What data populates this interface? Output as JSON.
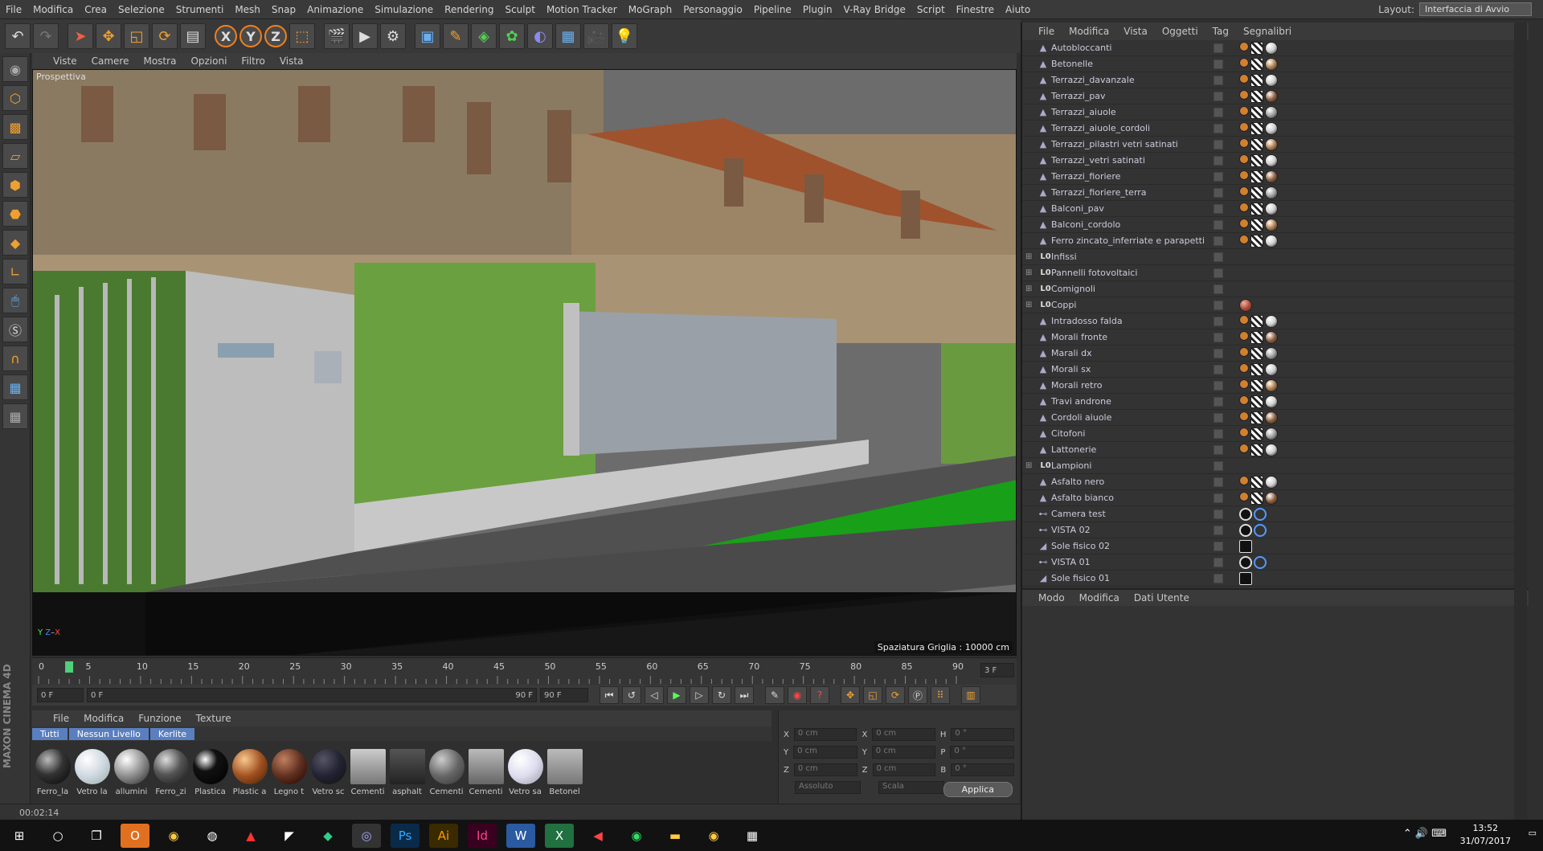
{
  "menubar": {
    "items": [
      "File",
      "Modifica",
      "Crea",
      "Selezione",
      "Strumenti",
      "Mesh",
      "Snap",
      "Animazione",
      "Simulazione",
      "Rendering",
      "Sculpt",
      "Motion Tracker",
      "MoGraph",
      "Personaggio",
      "Pipeline",
      "Plugin",
      "V-Ray Bridge",
      "Script",
      "Finestre",
      "Aiuto"
    ],
    "layout_label": "Layout:",
    "layout_value": "Interfaccia di Avvio"
  },
  "viewport": {
    "menu": [
      "Viste",
      "Camere",
      "Mostra",
      "Opzioni",
      "Filtro",
      "Vista"
    ],
    "label": "Prospettiva",
    "grid": "Spaziatura Griglia : 10000 cm"
  },
  "timeline": {
    "ticks": [
      "0",
      "5",
      "10",
      "15",
      "20",
      "25",
      "30",
      "35",
      "40",
      "45",
      "50",
      "55",
      "60",
      "65",
      "70",
      "75",
      "80",
      "85",
      "90"
    ],
    "current": "3",
    "frame_field": "3 F"
  },
  "playbar": {
    "start": "0 F",
    "field2": "0 F",
    "end": "90 F",
    "end2": "90 F"
  },
  "materials": {
    "menu": [
      "File",
      "Modifica",
      "Funzione",
      "Texture"
    ],
    "tabs": [
      "Tutti",
      "Nessun Livello",
      "Kerlite"
    ],
    "items": [
      "Ferro_la",
      "Vetro la",
      "allumini",
      "Ferro_zi",
      "Plastica",
      "Plastic a",
      "Legno t",
      "Vetro sc",
      "Cementi",
      "asphalt",
      "Cementi",
      "Cementi",
      "Vetro sa",
      "Betonel"
    ]
  },
  "coords": {
    "x1": "0 cm",
    "y1": "0 cm",
    "z1": "0 cm",
    "x2": "0 cm",
    "y2": "0 cm",
    "z2": "0 cm",
    "h": "0 °",
    "p": "0 °",
    "b": "0 °",
    "mode1": "Assoluto",
    "mode2": "Scala",
    "apply": "Applica"
  },
  "status": "00:02:14",
  "objects": {
    "menu": [
      "File",
      "Modifica",
      "Vista",
      "Oggetti",
      "Tag",
      "Segnalibri"
    ],
    "rows": [
      {
        "name": "Autobloccanti",
        "type": "poly"
      },
      {
        "name": "Betonelle",
        "type": "poly"
      },
      {
        "name": "Terrazzi_davanzale",
        "type": "poly"
      },
      {
        "name": "Terrazzi_pav",
        "type": "poly"
      },
      {
        "name": "Terrazzi_aiuole",
        "type": "poly"
      },
      {
        "name": "Terrazzi_aiuole_cordoli",
        "type": "poly"
      },
      {
        "name": "Terrazzi_pilastri vetri satinati",
        "type": "poly"
      },
      {
        "name": "Terrazzi_vetri satinati",
        "type": "poly"
      },
      {
        "name": "Terrazzi_fioriere",
        "type": "poly"
      },
      {
        "name": "Terrazzi_fioriere_terra",
        "type": "poly"
      },
      {
        "name": "Balconi_pav",
        "type": "poly"
      },
      {
        "name": "Balconi_cordolo",
        "type": "poly"
      },
      {
        "name": "Ferro zincato_inferriate e parapetti",
        "type": "poly"
      },
      {
        "name": "Infissi",
        "type": "null"
      },
      {
        "name": "Pannelli fotovoltaici",
        "type": "null"
      },
      {
        "name": "Comignoli",
        "type": "null"
      },
      {
        "name": "Coppi",
        "type": "null"
      },
      {
        "name": "Intradosso falda",
        "type": "poly"
      },
      {
        "name": "Morali fronte",
        "type": "poly"
      },
      {
        "name": "Marali dx",
        "type": "poly"
      },
      {
        "name": "Morali sx",
        "type": "poly"
      },
      {
        "name": "Morali retro",
        "type": "poly"
      },
      {
        "name": "Travi androne",
        "type": "poly"
      },
      {
        "name": "Cordoli aiuole",
        "type": "poly"
      },
      {
        "name": "Citofoni",
        "type": "poly"
      },
      {
        "name": "Lattonerie",
        "type": "poly"
      },
      {
        "name": "Lampioni",
        "type": "null"
      },
      {
        "name": "Asfalto nero",
        "type": "poly"
      },
      {
        "name": "Asfalto bianco",
        "type": "poly"
      },
      {
        "name": "Camera test",
        "type": "cam"
      },
      {
        "name": "VISTA 02",
        "type": "cam"
      },
      {
        "name": "Sole fisico 02",
        "type": "light"
      },
      {
        "name": "VISTA 01",
        "type": "cam"
      },
      {
        "name": "Sole fisico 01",
        "type": "light"
      }
    ]
  },
  "attributes": {
    "menu": [
      "Modo",
      "Modifica",
      "Dati Utente"
    ]
  },
  "taskbar": {
    "time": "13:52",
    "date": "31/07/2017"
  }
}
